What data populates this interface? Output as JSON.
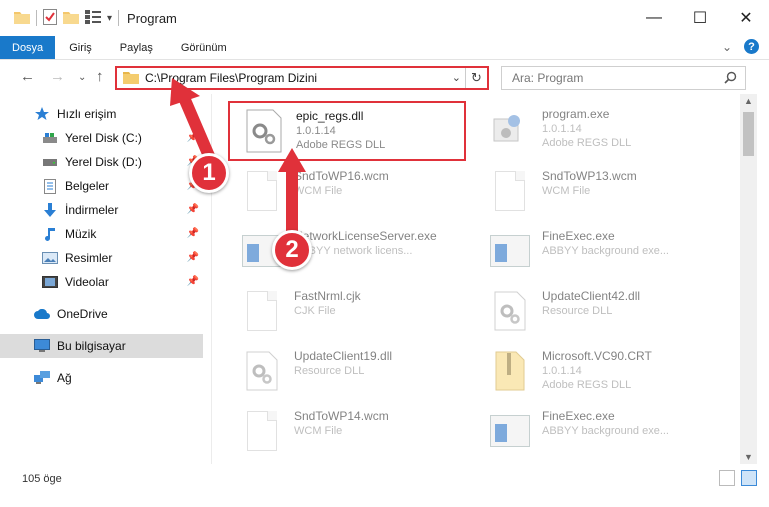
{
  "window": {
    "title": "Program",
    "minimize": "—",
    "maximize": "☐",
    "close": "✕"
  },
  "ribbon": {
    "tabs": [
      "Dosya",
      "Giriş",
      "Paylaş",
      "Görünüm"
    ],
    "expand": "⌄",
    "help": "?"
  },
  "nav": {
    "back": "←",
    "forward": "→",
    "recent": "⌄",
    "up": "↑",
    "address": "C:\\Program Files\\Program Dizini",
    "address_dropdown": "⌄",
    "refresh": "↻",
    "search_placeholder": "Ara: Program"
  },
  "sidebar": {
    "items": [
      {
        "label": "Hızlı erişim",
        "icon": "star-icon",
        "pinned": false
      },
      {
        "label": "Yerel Disk (C:)",
        "icon": "drive-icon",
        "pinned": true
      },
      {
        "label": "Yerel Disk (D:)",
        "icon": "drive-icon",
        "pinned": true
      },
      {
        "label": "Belgeler",
        "icon": "documents-icon",
        "pinned": true
      },
      {
        "label": "İndirmeler",
        "icon": "downloads-icon",
        "pinned": true
      },
      {
        "label": "Müzik",
        "icon": "music-icon",
        "pinned": true
      },
      {
        "label": "Resimler",
        "icon": "pictures-icon",
        "pinned": true
      },
      {
        "label": "Videolar",
        "icon": "videos-icon",
        "pinned": true
      },
      {
        "label": "OneDrive",
        "icon": "cloud-icon",
        "pinned": false
      },
      {
        "label": "Bu bilgisayar",
        "icon": "computer-icon",
        "pinned": false
      },
      {
        "label": "Ağ",
        "icon": "network-icon",
        "pinned": false
      }
    ],
    "pin_glyph": "📌"
  },
  "files": [
    {
      "name": "epic_regs.dll",
      "line1": "1.0.1.14",
      "line2": "Adobe REGS DLL",
      "icon": "dll-gear-icon",
      "selected": true
    },
    {
      "name": "program.exe",
      "line1": "1.0.1.14",
      "line2": "Adobe REGS DLL",
      "icon": "exe-icon",
      "selected": false
    },
    {
      "name": "SndToWP16.wcm",
      "line1": "WCM File",
      "line2": "",
      "icon": "file-icon",
      "selected": false
    },
    {
      "name": "SndToWP13.wcm",
      "line1": "WCM File",
      "line2": "",
      "icon": "file-icon",
      "selected": false
    },
    {
      "name": "NetworkLicenseServer.exe",
      "line1": "ABBYY network licens...",
      "line2": "",
      "icon": "window-app-icon",
      "selected": false
    },
    {
      "name": "FineExec.exe",
      "line1": "ABBYY background exe...",
      "line2": "",
      "icon": "window-app-icon",
      "selected": false
    },
    {
      "name": "FastNrml.cjk",
      "line1": "CJK File",
      "line2": "",
      "icon": "file-icon",
      "selected": false
    },
    {
      "name": "UpdateClient42.dll",
      "line1": "Resource DLL",
      "line2": "",
      "icon": "dll-gear-icon",
      "selected": false
    },
    {
      "name": "UpdateClient19.dll",
      "line1": "Resource DLL",
      "line2": "",
      "icon": "dll-gear-icon",
      "selected": false
    },
    {
      "name": "Microsoft.VC90.CRT",
      "line1": "1.0.1.14",
      "line2": "Adobe REGS DLL",
      "icon": "zip-icon",
      "selected": false
    },
    {
      "name": "SndToWP14.wcm",
      "line1": "WCM File",
      "line2": "",
      "icon": "file-icon",
      "selected": false
    },
    {
      "name": "FineExec.exe",
      "line1": "ABBYY background exe...",
      "line2": "",
      "icon": "window-app-icon",
      "selected": false
    }
  ],
  "status": {
    "count": "105 öge"
  },
  "annotations": {
    "step1": "1",
    "step2": "2",
    "color": "#e0313a"
  },
  "colors": {
    "accent": "#1979ca",
    "highlight": "#e0313a",
    "selected_nav": "#dcdcdc"
  }
}
